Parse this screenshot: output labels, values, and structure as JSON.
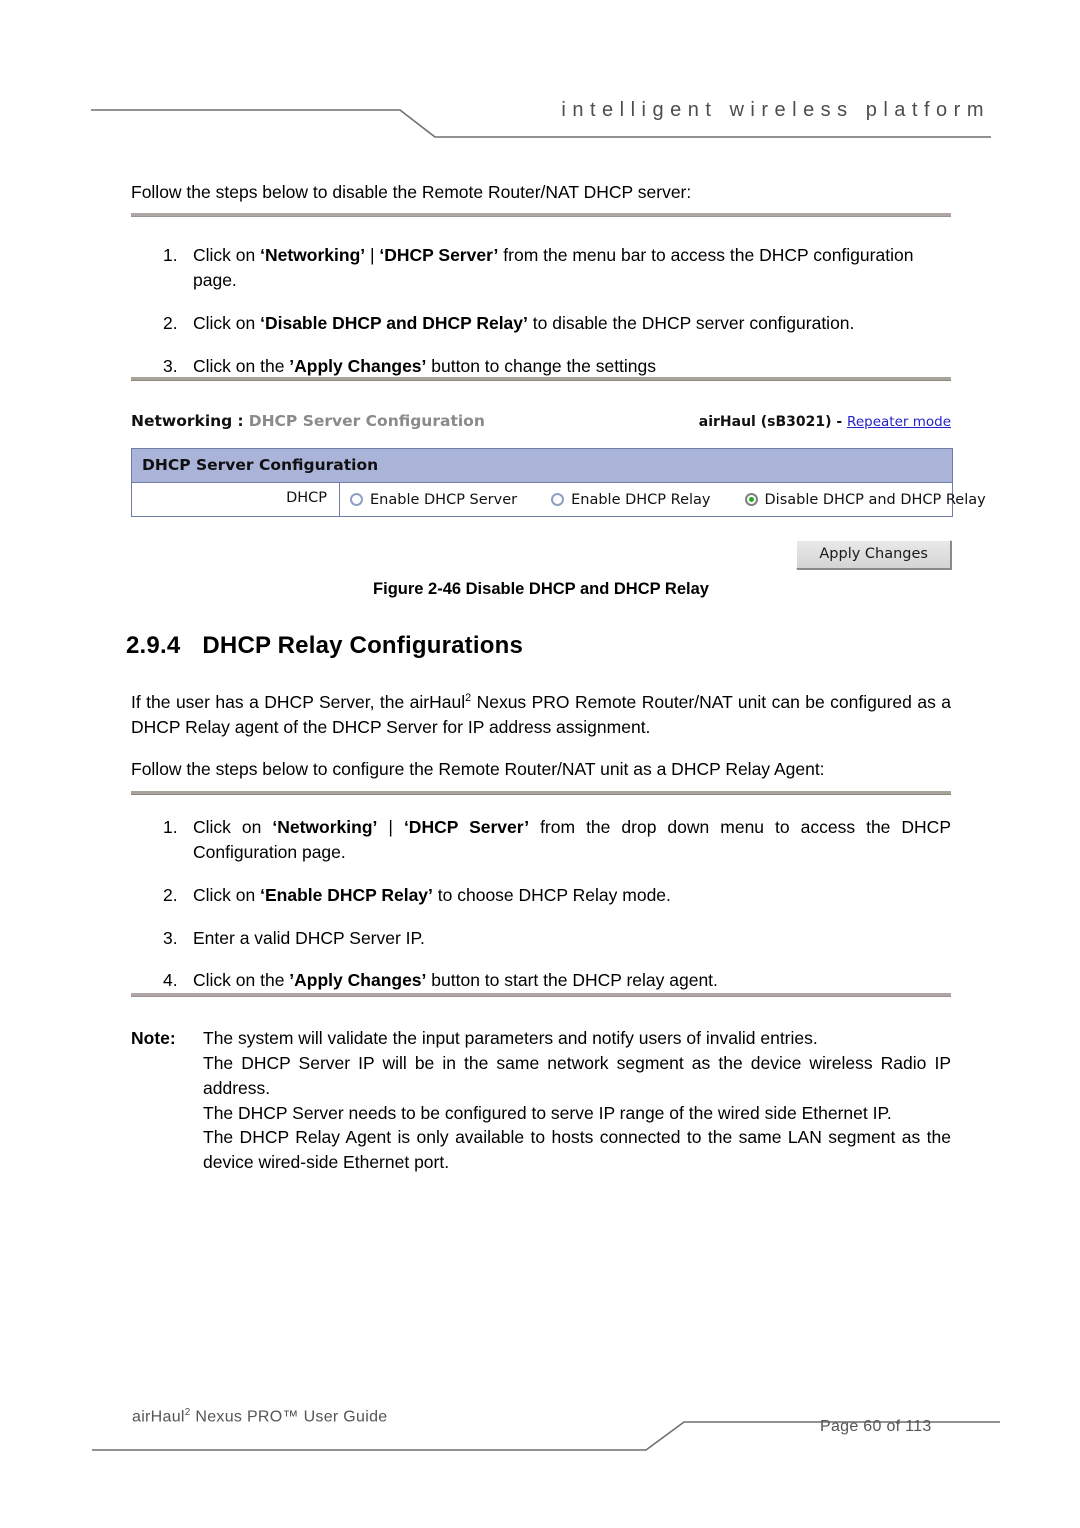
{
  "header": {
    "tagline": "intelligent   wireless   platform"
  },
  "intro": {
    "lead": "Follow the steps below to disable the Remote Router/NAT DHCP server:"
  },
  "steps_disable": [
    {
      "num": "1.",
      "parts": [
        {
          "t": "Click on ",
          "b": false
        },
        {
          "t": "‘Networking’",
          "b": true
        },
        {
          "t": " | ",
          "b": false
        },
        {
          "t": "‘DHCP Server’",
          "b": true
        },
        {
          "t": " from the menu bar to access the DHCP configuration page.",
          "b": false
        }
      ]
    },
    {
      "num": "2.",
      "parts": [
        {
          "t": "Click on ",
          "b": false
        },
        {
          "t": "‘Disable DHCP and DHCP Relay’",
          "b": true
        },
        {
          "t": " to disable the DHCP server configuration.",
          "b": false
        }
      ]
    },
    {
      "num": "3.",
      "parts": [
        {
          "t": "Click on the ",
          "b": false
        },
        {
          "t": "’Apply Changes’",
          "b": true
        },
        {
          "t": " button to change the settings",
          "b": false
        }
      ]
    }
  ],
  "device_ui": {
    "breadcrumb_section": "Networking",
    "breadcrumb_separator": " : ",
    "breadcrumb_page": "DHCP Server Configuration",
    "device_name": "airHaul (sB3021) - ",
    "mode_link": "Repeater mode",
    "panel_title": "DHCP Server Configuration",
    "row_label": "DHCP",
    "options": [
      {
        "label": "Enable DHCP Server",
        "selected": false
      },
      {
        "label": "Enable DHCP Relay",
        "selected": false
      },
      {
        "label": "Disable DHCP and DHCP Relay",
        "selected": true
      }
    ],
    "apply_label": "Apply Changes",
    "accent_header": "#aab4d8",
    "accent_selected": "#22aa22",
    "link_color": "#2222cc"
  },
  "figure": {
    "caption": "Figure 2-46 Disable DHCP and DHCP Relay"
  },
  "section": {
    "number": "2.9.4",
    "title": "DHCP Relay Configurations"
  },
  "body": {
    "p1_a": "If the user has a DHCP Server, the airHaul",
    "p1_sup": "2",
    "p1_b": " Nexus PRO Remote Router/NAT unit can be configured as a DHCP Relay agent of the DHCP Server for IP address assignment.",
    "p2": "Follow the steps below to configure the Remote Router/NAT unit as a DHCP Relay Agent:"
  },
  "steps_relay": [
    {
      "num": "1.",
      "parts": [
        {
          "t": "Click on ",
          "b": false
        },
        {
          "t": "‘Networking’",
          "b": true
        },
        {
          "t": " | ",
          "b": false
        },
        {
          "t": "‘DHCP Server’",
          "b": true
        },
        {
          "t": " from the drop down menu to access the DHCP Configuration page.",
          "b": false
        }
      ]
    },
    {
      "num": "2.",
      "parts": [
        {
          "t": "Click on ",
          "b": false
        },
        {
          "t": "‘Enable DHCP Relay’",
          "b": true
        },
        {
          "t": " to choose DHCP Relay mode.",
          "b": false
        }
      ]
    },
    {
      "num": "3.",
      "parts": [
        {
          "t": "Enter a valid DHCP Server IP.",
          "b": false
        }
      ]
    },
    {
      "num": "4.",
      "parts": [
        {
          "t": "Click on the ",
          "b": false
        },
        {
          "t": "’Apply Changes’",
          "b": true
        },
        {
          "t": " button to start the DHCP relay agent.",
          "b": false
        }
      ]
    }
  ],
  "note": {
    "label": "Note:",
    "lines": [
      "The system will validate the input parameters and notify users of invalid entries.",
      "The DHCP Server IP will be in the same network segment as the device wireless Radio IP address.",
      "The DHCP Server needs to be configured to serve IP range of the wired side Ethernet IP.",
      "The DHCP Relay Agent is only available to hosts connected to the same LAN segment as the device wired-side Ethernet port."
    ]
  },
  "footer": {
    "left_a": "airHaul",
    "left_sup": "2",
    "left_b": " Nexus PRO™ User Guide",
    "right": "Page 60 of 113"
  }
}
